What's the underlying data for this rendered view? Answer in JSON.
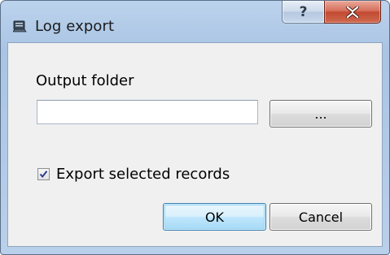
{
  "window": {
    "title": "Log export",
    "title_icon": "app-icon"
  },
  "caption_buttons": {
    "help_icon": "question-mark-icon",
    "help_glyph": "?",
    "close_icon": "close-icon",
    "close_glyph": "X"
  },
  "form": {
    "output_label": "Output folder",
    "output_value": "",
    "browse_label": "...",
    "export_selected_label": "Export selected records",
    "export_selected_checked": true,
    "ok_label": "OK",
    "cancel_label": "Cancel"
  },
  "colors": {
    "close_button": "#c14a32",
    "frame": "#b9d0ea",
    "client_bg": "#f0f0f0",
    "default_button_border": "#3c7fb1"
  }
}
